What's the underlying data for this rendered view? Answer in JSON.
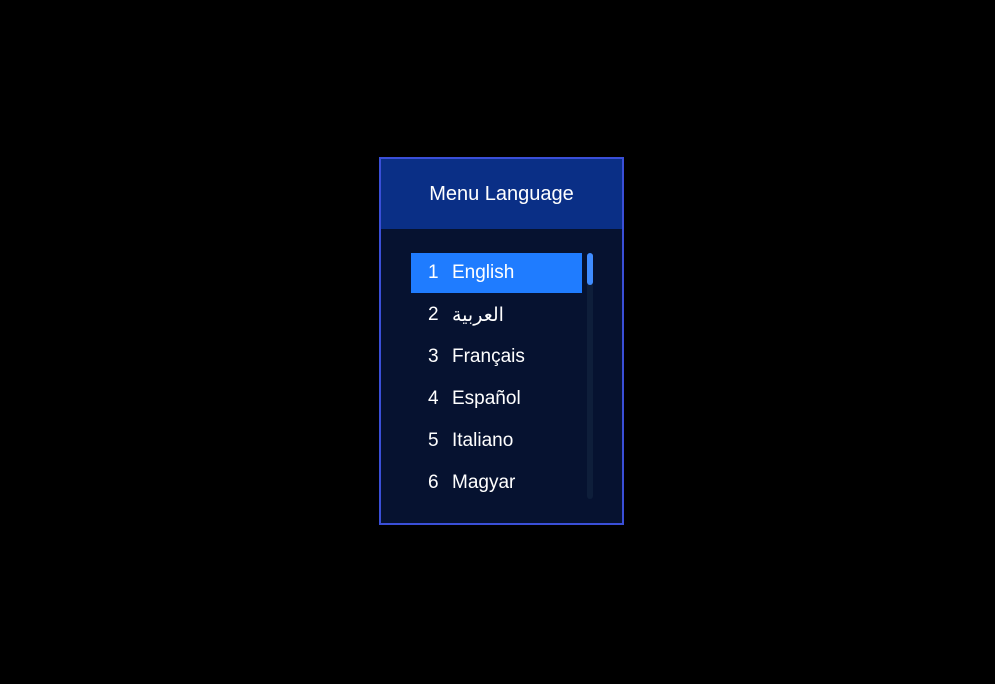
{
  "dialog": {
    "title": "Menu Language"
  },
  "menu": {
    "selected_index": 0,
    "items": [
      {
        "number": "1",
        "label": "English"
      },
      {
        "number": "2",
        "label": "العربية"
      },
      {
        "number": "3",
        "label": "Français"
      },
      {
        "number": "4",
        "label": "Español"
      },
      {
        "number": "5",
        "label": "Italiano"
      },
      {
        "number": "6",
        "label": "Magyar"
      }
    ]
  },
  "scrollbar": {
    "position_fraction": 0.0
  },
  "colors": {
    "background": "#000000",
    "dialog_border": "#3a4fd8",
    "header_background": "#0a2f86",
    "list_background": "#061230",
    "selection": "#1f7cff",
    "scroll_thumb": "#3f8cff"
  }
}
